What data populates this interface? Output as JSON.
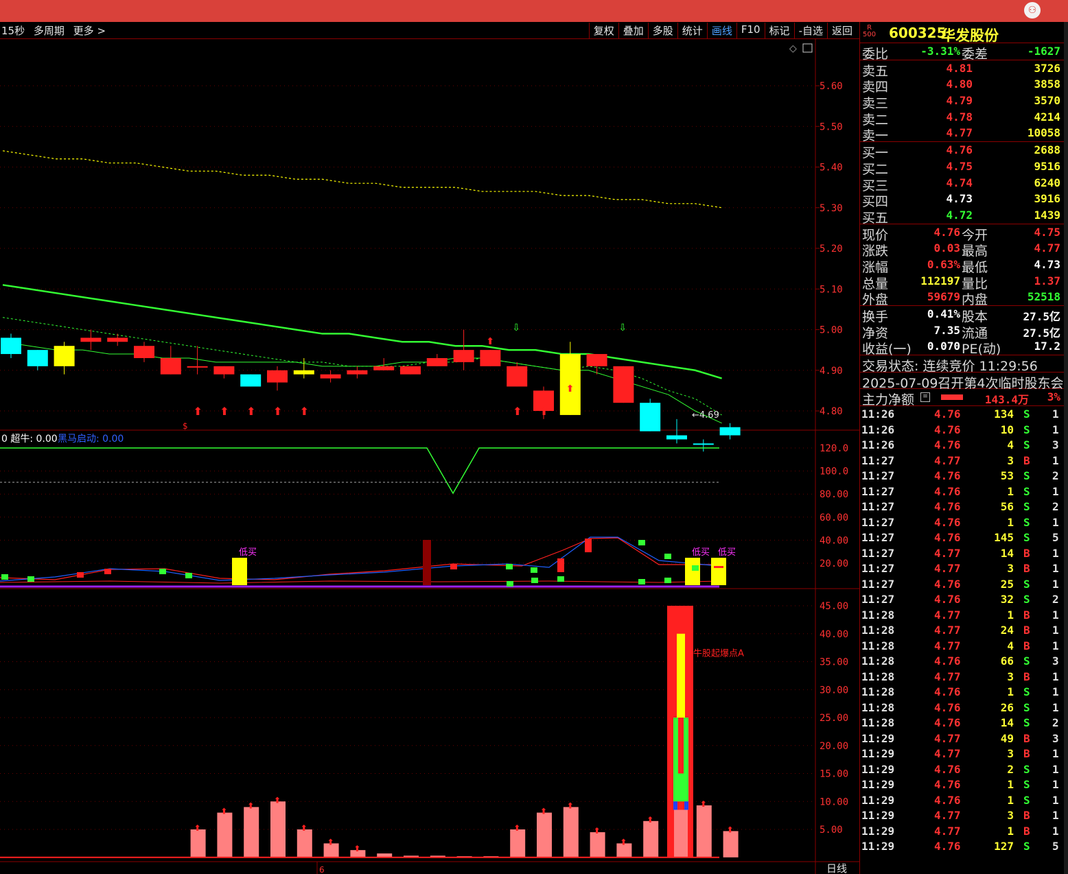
{
  "menu": {
    "left": [
      "15秒",
      "多周期",
      "更多 >"
    ],
    "right": [
      "复权",
      "叠加",
      "多股",
      "统计",
      "画线",
      "F10",
      "标记",
      "-自选",
      "返回"
    ],
    "active": "画线"
  },
  "stock": {
    "code": "600325",
    "name": "华发股份",
    "logo_top": "R",
    "logo_bottom": "500"
  },
  "quote": {
    "weibi_label": "委比",
    "weibi": "-3.31%",
    "weicha_label": "委差",
    "weicha": "-1627",
    "sell": [
      {
        "label": "卖五",
        "price": "4.81",
        "vol": "3726"
      },
      {
        "label": "卖四",
        "price": "4.80",
        "vol": "3858"
      },
      {
        "label": "卖三",
        "price": "4.79",
        "vol": "3570"
      },
      {
        "label": "卖二",
        "price": "4.78",
        "vol": "4214"
      },
      {
        "label": "卖一",
        "price": "4.77",
        "vol": "10058"
      }
    ],
    "buy": [
      {
        "label": "买一",
        "price": "4.76",
        "vol": "2688"
      },
      {
        "label": "买二",
        "price": "4.75",
        "vol": "9516"
      },
      {
        "label": "买三",
        "price": "4.74",
        "vol": "6240"
      },
      {
        "label": "买四",
        "price": "4.73",
        "vol": "3916"
      },
      {
        "label": "买五",
        "price": "4.72",
        "vol": "1439"
      }
    ],
    "stats": [
      {
        "l1": "现价",
        "v1": "4.76",
        "l2": "今开",
        "v2": "4.75"
      },
      {
        "l1": "涨跌",
        "v1": "0.03",
        "l2": "最高",
        "v2": "4.77"
      },
      {
        "l1": "涨幅",
        "v1": "0.63%",
        "l2": "最低",
        "v2": "4.73"
      },
      {
        "l1": "总量",
        "v1": "112197",
        "l2": "量比",
        "v2": "1.37"
      },
      {
        "l1": "外盘",
        "v1": "59679",
        "l2": "内盘",
        "v2": "52518"
      }
    ],
    "stats2": [
      {
        "l1": "换手",
        "v1": "0.41%",
        "l2": "股本",
        "v2": "27.5亿"
      },
      {
        "l1": "净资",
        "v1": "7.35",
        "l2": "流通",
        "v2": "27.5亿"
      },
      {
        "l1": "收益(一)",
        "v1": "0.070",
        "l2": "PE(动)",
        "v2": "17.2"
      }
    ],
    "trade_state": "交易状态: 连续竞价 11:29:56",
    "notice": "2025-07-09召开第4次临时股东会",
    "main_net": {
      "label": "主力净额",
      "value": "143.4万",
      "pct": "3%"
    }
  },
  "ticks": [
    {
      "t": "11:26",
      "p": "4.76",
      "q": "134",
      "d": "S",
      "n": "1"
    },
    {
      "t": "11:26",
      "p": "4.76",
      "q": "10",
      "d": "S",
      "n": "1"
    },
    {
      "t": "11:26",
      "p": "4.76",
      "q": "4",
      "d": "S",
      "n": "3"
    },
    {
      "t": "11:27",
      "p": "4.77",
      "q": "3",
      "d": "B",
      "n": "1"
    },
    {
      "t": "11:27",
      "p": "4.76",
      "q": "53",
      "d": "S",
      "n": "2"
    },
    {
      "t": "11:27",
      "p": "4.76",
      "q": "1",
      "d": "S",
      "n": "1"
    },
    {
      "t": "11:27",
      "p": "4.76",
      "q": "56",
      "d": "S",
      "n": "2"
    },
    {
      "t": "11:27",
      "p": "4.76",
      "q": "1",
      "d": "S",
      "n": "1"
    },
    {
      "t": "11:27",
      "p": "4.76",
      "q": "145",
      "d": "S",
      "n": "5"
    },
    {
      "t": "11:27",
      "p": "4.77",
      "q": "14",
      "d": "B",
      "n": "1"
    },
    {
      "t": "11:27",
      "p": "4.77",
      "q": "3",
      "d": "B",
      "n": "1"
    },
    {
      "t": "11:27",
      "p": "4.76",
      "q": "25",
      "d": "S",
      "n": "1"
    },
    {
      "t": "11:27",
      "p": "4.76",
      "q": "32",
      "d": "S",
      "n": "2"
    },
    {
      "t": "11:28",
      "p": "4.77",
      "q": "1",
      "d": "B",
      "n": "1"
    },
    {
      "t": "11:28",
      "p": "4.77",
      "q": "24",
      "d": "B",
      "n": "1"
    },
    {
      "t": "11:28",
      "p": "4.77",
      "q": "4",
      "d": "B",
      "n": "1"
    },
    {
      "t": "11:28",
      "p": "4.76",
      "q": "66",
      "d": "S",
      "n": "3"
    },
    {
      "t": "11:28",
      "p": "4.77",
      "q": "3",
      "d": "B",
      "n": "1"
    },
    {
      "t": "11:28",
      "p": "4.76",
      "q": "1",
      "d": "S",
      "n": "1"
    },
    {
      "t": "11:28",
      "p": "4.76",
      "q": "26",
      "d": "S",
      "n": "1"
    },
    {
      "t": "11:28",
      "p": "4.76",
      "q": "14",
      "d": "S",
      "n": "2"
    },
    {
      "t": "11:29",
      "p": "4.77",
      "q": "49",
      "d": "B",
      "n": "3"
    },
    {
      "t": "11:29",
      "p": "4.77",
      "q": "3",
      "d": "B",
      "n": "1"
    },
    {
      "t": "11:29",
      "p": "4.76",
      "q": "2",
      "d": "S",
      "n": "1"
    },
    {
      "t": "11:29",
      "p": "4.76",
      "q": "1",
      "d": "S",
      "n": "1"
    },
    {
      "t": "11:29",
      "p": "4.76",
      "q": "1",
      "d": "S",
      "n": "1"
    },
    {
      "t": "11:29",
      "p": "4.77",
      "q": "3",
      "d": "B",
      "n": "1"
    },
    {
      "t": "11:29",
      "p": "4.77",
      "q": "1",
      "d": "B",
      "n": "1"
    },
    {
      "t": "11:29",
      "p": "4.76",
      "q": "127",
      "d": "S",
      "n": "5"
    }
  ],
  "chart_data": [
    {
      "type": "candlestick",
      "ylim": [
        4.69,
        5.66
      ],
      "yticks": [
        5.6,
        5.5,
        5.4,
        5.3,
        5.2,
        5.1,
        5.0,
        4.9,
        4.8
      ],
      "candles": [
        {
          "o": 4.98,
          "c": 4.94,
          "h": 4.99,
          "l": 4.93,
          "col": "cyan"
        },
        {
          "o": 4.95,
          "c": 4.91,
          "h": 4.95,
          "l": 4.9,
          "col": "cyan"
        },
        {
          "o": 4.91,
          "c": 4.96,
          "h": 4.97,
          "l": 4.89,
          "col": "yellow"
        },
        {
          "o": 4.97,
          "c": 4.98,
          "h": 5.0,
          "l": 4.95,
          "col": "red"
        },
        {
          "o": 4.97,
          "c": 4.98,
          "h": 4.99,
          "l": 4.96,
          "col": "red"
        },
        {
          "o": 4.93,
          "c": 4.96,
          "h": 4.97,
          "l": 4.92,
          "col": "red"
        },
        {
          "o": 4.89,
          "c": 4.93,
          "h": 4.96,
          "l": 4.89,
          "col": "red"
        },
        {
          "o": 4.91,
          "c": 4.91,
          "h": 4.96,
          "l": 4.89,
          "col": "red"
        },
        {
          "o": 4.89,
          "c": 4.91,
          "h": 4.91,
          "l": 4.88,
          "col": "red"
        },
        {
          "o": 4.89,
          "c": 4.86,
          "h": 4.89,
          "l": 4.86,
          "col": "cyan"
        },
        {
          "o": 4.87,
          "c": 4.9,
          "h": 4.91,
          "l": 4.85,
          "col": "red"
        },
        {
          "o": 4.89,
          "c": 4.9,
          "h": 4.93,
          "l": 4.88,
          "col": "yellow"
        },
        {
          "o": 4.88,
          "c": 4.89,
          "h": 4.9,
          "l": 4.87,
          "col": "red"
        },
        {
          "o": 4.89,
          "c": 4.9,
          "h": 4.91,
          "l": 4.88,
          "col": "red"
        },
        {
          "o": 4.9,
          "c": 4.91,
          "h": 4.93,
          "l": 4.9,
          "col": "red"
        },
        {
          "o": 4.89,
          "c": 4.91,
          "h": 4.91,
          "l": 4.89,
          "col": "red"
        },
        {
          "o": 4.91,
          "c": 4.93,
          "h": 4.94,
          "l": 4.91,
          "col": "red"
        },
        {
          "o": 4.92,
          "c": 4.95,
          "h": 5.0,
          "l": 4.9,
          "col": "red"
        },
        {
          "o": 4.91,
          "c": 4.95,
          "h": 4.95,
          "l": 4.91,
          "col": "red"
        },
        {
          "o": 4.86,
          "c": 4.91,
          "h": 4.92,
          "l": 4.86,
          "col": "red"
        },
        {
          "o": 4.8,
          "c": 4.85,
          "h": 4.86,
          "l": 4.78,
          "col": "red"
        },
        {
          "o": 4.79,
          "c": 4.94,
          "h": 4.97,
          "l": 4.79,
          "col": "yellow"
        },
        {
          "o": 4.91,
          "c": 4.94,
          "h": 4.94,
          "l": 4.89,
          "col": "red"
        },
        {
          "o": 4.82,
          "c": 4.91,
          "h": 4.91,
          "l": 4.82,
          "col": "red"
        },
        {
          "o": 4.82,
          "c": 4.75,
          "h": 4.83,
          "l": 4.75,
          "col": "cyan"
        },
        {
          "o": 4.74,
          "c": 4.73,
          "h": 4.78,
          "l": 4.72,
          "col": "cyan"
        },
        {
          "o": 4.72,
          "c": 4.72,
          "h": 4.73,
          "l": 4.7,
          "col": "cyan"
        },
        {
          "o": 4.76,
          "c": 4.74,
          "h": 4.77,
          "l": 4.73,
          "col": "cyan"
        }
      ],
      "low_label": "4.69"
    },
    {
      "type": "line",
      "ylim": [
        0,
        130
      ],
      "yticks": [
        120.0,
        100.0,
        80.0,
        60.0,
        40.0,
        20.0
      ],
      "legend": [
        "超牛: 0.00",
        "黑马启动: 0.00"
      ],
      "buy_label": "低买"
    },
    {
      "type": "bar",
      "ylim": [
        0,
        47
      ],
      "yticks": [
        45.0,
        40.0,
        35.0,
        30.0,
        25.0,
        20.0,
        15.0,
        10.0,
        5.0
      ],
      "values": [
        0,
        0,
        0,
        0,
        0,
        0,
        0,
        5,
        8,
        9,
        10,
        5,
        2.5,
        1.3,
        0.7,
        0.3,
        0.3,
        0.2,
        0.2,
        5,
        8,
        9,
        4.5,
        2.5,
        6.5,
        45,
        9.3,
        4.7
      ],
      "annotation": "牛股起爆点A",
      "x_label": "6",
      "period_label": "日线"
    }
  ]
}
